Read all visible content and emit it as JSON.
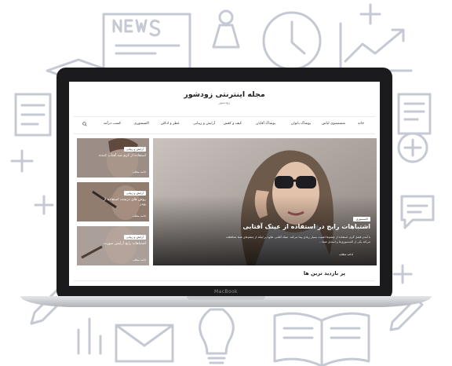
{
  "site": {
    "title": "مجله اینترنتی زودشور",
    "tagline": "زودشور"
  },
  "nav": {
    "items": [
      {
        "label": "خانه"
      },
      {
        "label": "شستشوی لباس"
      },
      {
        "label": "پوشاک بانوان"
      },
      {
        "label": "پوشاک آقایان"
      },
      {
        "label": "کیف و کفش"
      },
      {
        "label": "آرایش و زیبایی"
      },
      {
        "label": "عطر و ادکلن"
      },
      {
        "label": "اکسسوری"
      },
      {
        "label": "کسب درآمد"
      }
    ],
    "search_icon": "search-icon"
  },
  "featured": {
    "category": "اکسسوری",
    "title": "اشتباهات رایج در استفاده از عینک آفتابی",
    "excerpt": "با آمدن فصل گرم، استفاده از چشم‌ها اهمیت بسیار زیادی پیدا می‌کند. عینک آفتابی علاوه بر اینکه از چشم‌های شما محافظت می‌کند یکی از اکسسوری‌ها و استایل شما...",
    "read_more": "ادامه مطلب"
  },
  "side_posts": [
    {
      "category": "آرایش و زیبایی",
      "title": "استفاده از کرم ضد آفتاب کننده",
      "read_more": "ادامه مطلب"
    },
    {
      "category": "آرایش و زیبایی",
      "title": "روش های درست استفاده از پودر",
      "read_more": "ادامه مطلب"
    },
    {
      "category": "آرایش و زیبایی",
      "title": "اشتباهات رایج آرایش صورت",
      "read_more": "ادامه مطلب"
    }
  ],
  "section": {
    "most_viewed": "پر بازدید ترین ها"
  },
  "device": {
    "brand": "MacBook"
  },
  "colors": {
    "doodle": "#c5c9d3",
    "bezel": "#1b1b1d",
    "hero_overlay": "#2a2626"
  }
}
